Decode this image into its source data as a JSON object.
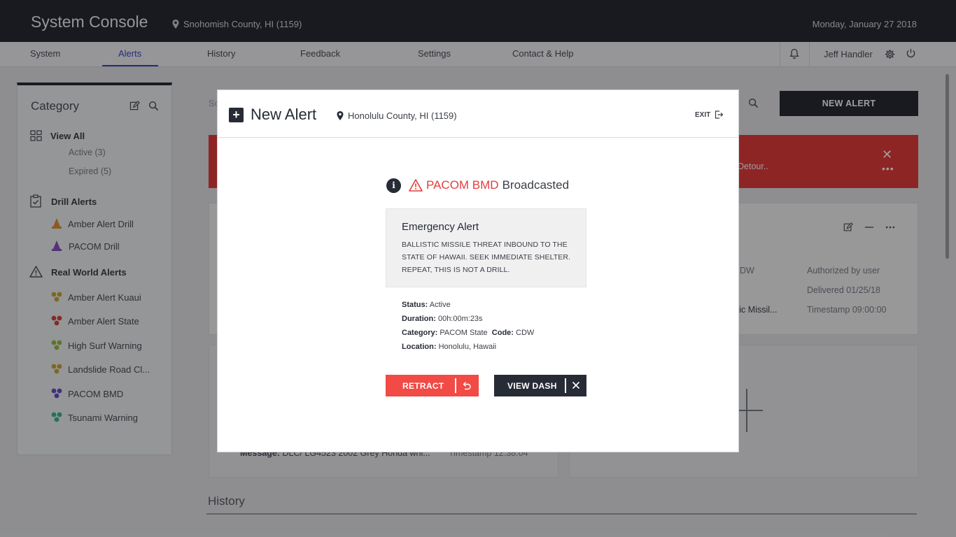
{
  "header": {
    "app_title": "System Console",
    "location": "Snohomish County, HI (1159)",
    "date": "Monday, January 27 2018"
  },
  "nav": {
    "tabs": [
      {
        "label": "System"
      },
      {
        "label": "Alerts",
        "active": true
      },
      {
        "label": "History"
      },
      {
        "label": "Feedback"
      },
      {
        "label": "Settings"
      },
      {
        "label": "Contact & Help"
      }
    ],
    "user_name": "Jeff Handler"
  },
  "sidebar": {
    "title": "Category",
    "view_all": "View All",
    "active": "Active (3)",
    "expired": "Expired (5)",
    "drill_group": "Drill Alerts",
    "drill_items": [
      "Amber Alert Drill",
      "PACOM Drill"
    ],
    "real_group": "Real World Alerts",
    "real_items": [
      "Amber Alert Kuaui",
      "Amber Alert State",
      "High Surf Warning",
      "Landslide Road Cl...",
      "PACOM BMD",
      "Tsunami Warning"
    ]
  },
  "background": {
    "search_placeholder": "Sc",
    "new_alert_label": "NEW ALERT",
    "banner_text": "Detour..",
    "banner_close": "✕",
    "banner_more": "•••",
    "card1": {
      "code_partial": "DW",
      "authorized": "Authorized by user",
      "delivered": "Delivered 01/25/18",
      "message_partial": "listic Missil...",
      "timestamp": "Timestamp 09:00:00"
    },
    "card2": {
      "message_label": "Message:",
      "message_value": "DLC/ LG4523 2002 Grey Honda whi...",
      "timestamp": "Timestamp 12:38:04"
    },
    "history_title": "History"
  },
  "modal": {
    "title": "New Alert",
    "location": "Honolulu County, HI (1159)",
    "exit_label": "EXIT",
    "status_alert": "PACOM BMD",
    "status_word": "Broadcasted",
    "emergency_title": "Emergency Alert",
    "emergency_body": "BALLISTIC MISSILE THREAT INBOUND TO THE STATE OF HAWAII. SEEK IMMEDIATE SHELTER. REPEAT, THIS IS NOT A DRILL.",
    "status_label": "Status:",
    "status_value": "Active",
    "duration_label": "Duration:",
    "duration_value": "00h:00m:23s",
    "category_label": "Category:",
    "category_value": "PACOM State",
    "code_label": "Code:",
    "code_value": "CDW",
    "location_label": "Location:",
    "location_value": "Honolulu, Hawaii",
    "retract_label": "RETRACT",
    "view_dash_label": "VIEW DASH"
  },
  "colors": {
    "dark": "#272b35",
    "accent_blue": "#3b46c9",
    "alert_red": "#e53d3d",
    "amber": "#e0913a",
    "purple": "#8a4fc7",
    "gold": "#c9a93a",
    "red": "#d84343",
    "green": "#9ab94a",
    "pacom_purple": "#6a4fc7",
    "teal": "#3fb39a"
  }
}
